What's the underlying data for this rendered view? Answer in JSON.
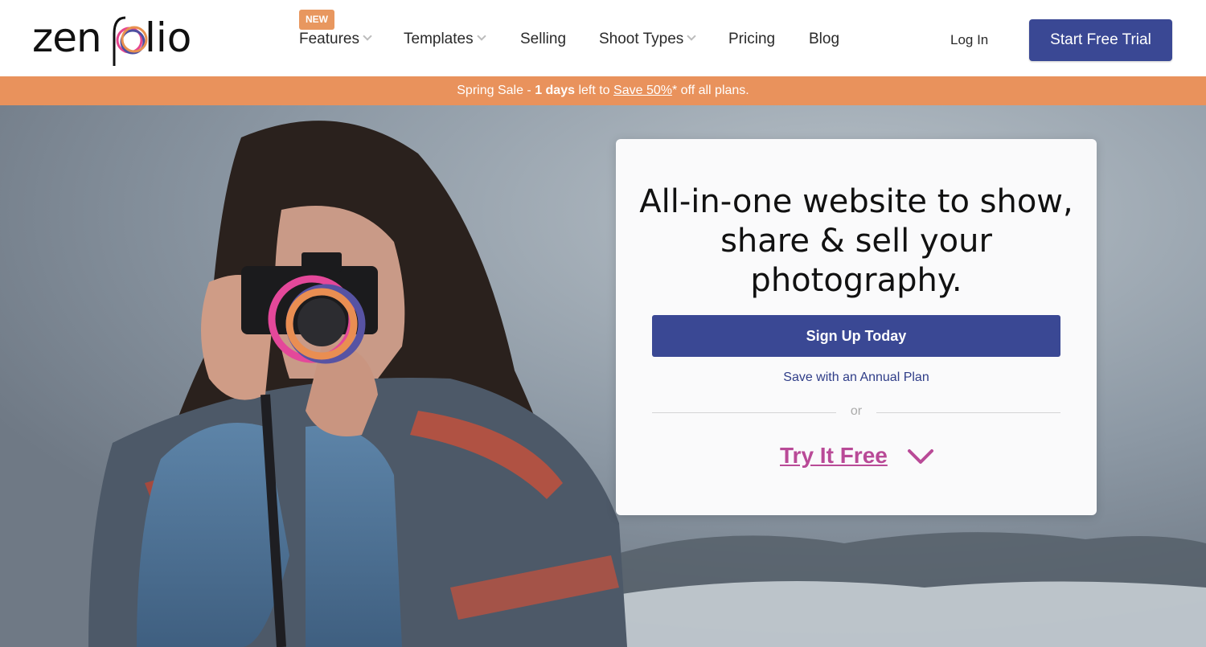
{
  "brand": {
    "name": "zenfolio"
  },
  "header": {
    "nav": [
      {
        "label": "Features",
        "dropdown": true
      },
      {
        "label": "Templates",
        "dropdown": true
      },
      {
        "label": "Selling",
        "dropdown": false
      },
      {
        "label": "Shoot Types",
        "dropdown": true
      },
      {
        "label": "Pricing",
        "dropdown": false
      },
      {
        "label": "Blog",
        "dropdown": false
      }
    ],
    "new_badge": "NEW",
    "login_label": "Log In",
    "trial_label": "Start Free Trial"
  },
  "banner": {
    "prefix": "Spring Sale - ",
    "days": "1 days",
    "middle": " left to ",
    "link": "Save 50%",
    "suffix": "* off all plans."
  },
  "hero": {
    "headline": "All-in-one website to show, share & sell your photography.",
    "signup_label": "Sign Up Today",
    "annual_label": "Save with an Annual Plan",
    "or_label": "or",
    "try_label": "Try It Free"
  },
  "colors": {
    "primary": "#3a4894",
    "banner": "#e9925c",
    "accent_pink": "#b94a97",
    "badge": "#e8975f"
  }
}
